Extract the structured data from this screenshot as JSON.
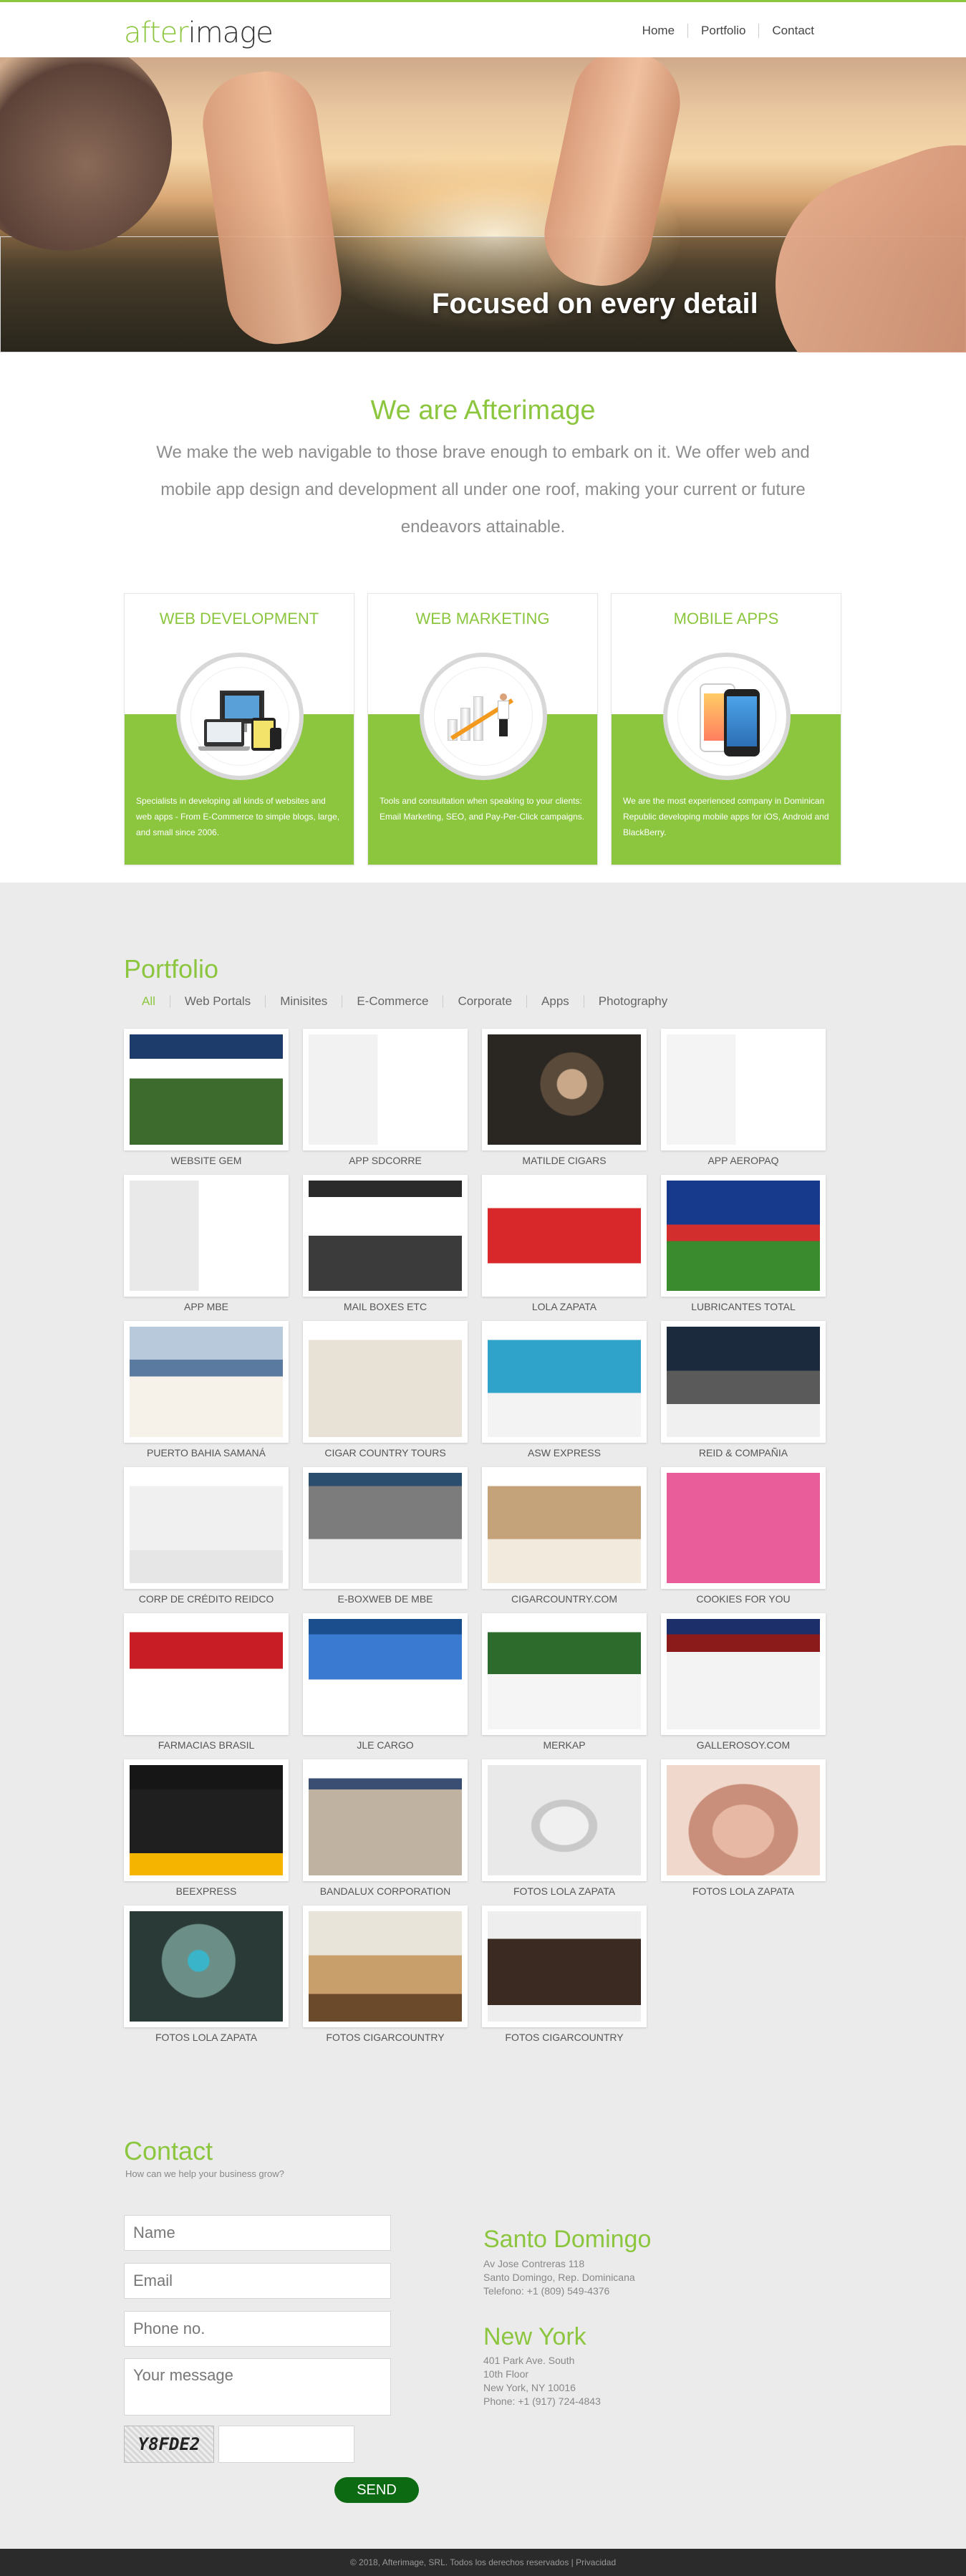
{
  "header": {
    "logo_part1": "after",
    "logo_part2": "image",
    "nav": [
      "Home",
      "Portfolio",
      "Contact"
    ]
  },
  "hero": {
    "caption": "Focused on every detail"
  },
  "intro": {
    "heading_prefix": "We are ",
    "heading_brand": "Afterimage",
    "body": "We make the web navigable to those brave enough to embark on it. We offer web and mobile app design and development all under one roof, making your current or future endeavors attainable."
  },
  "services": [
    {
      "title": "WEB DEVELOPMENT",
      "desc": "Specialists in developing all kinds of websites and web apps - From E-Commerce to simple blogs, large, and small since 2006."
    },
    {
      "title": "WEB MARKETING",
      "desc": "Tools and consultation when speaking to your clients: Email Marketing, SEO, and Pay-Per-Click campaigns."
    },
    {
      "title": "MOBILE APPS",
      "desc": "We are the most experienced company in Dominican Republic developing mobile apps for iOS, Android and BlackBerry."
    }
  ],
  "portfolio": {
    "title": "Portfolio",
    "filters": [
      "All",
      "Web Portals",
      "Minisites",
      "E-Commerce",
      "Corporate",
      "Apps",
      "Photography"
    ],
    "items": [
      "WEBSITE GEM",
      "APP SDCORRE",
      "MATILDE CIGARS",
      "APP AEROPAQ",
      "APP MBE",
      "MAIL BOXES ETC",
      "LOLA ZAPATA",
      "LUBRICANTES TOTAL",
      "PUERTO BAHIA SAMANÁ",
      "CIGAR COUNTRY TOURS",
      "ASW EXPRESS",
      "REID & COMPAÑIA",
      "CORP DE CRÉDITO REIDCO",
      "E-BOXWEB DE MBE",
      "CIGARCOUNTRY.COM",
      "COOKIES FOR YOU",
      "FARMACIAS BRASIL",
      "JLE CARGO",
      "MERKAP",
      "GALLEROSOY.COM",
      "BEEXPRESS",
      "BANDALUX CORPORATION",
      "FOTOS LOLA ZAPATA",
      "FOTOS LOLA ZAPATA",
      "FOTOS LOLA ZAPATA",
      "FOTOS CIGARCOUNTRY",
      "FOTOS CIGARCOUNTRY"
    ]
  },
  "contact": {
    "title": "Contact",
    "subtitle": "How can we help your business grow?",
    "placeholders": {
      "name": "Name",
      "email": "Email",
      "phone": "Phone no.",
      "message": "Your message"
    },
    "captcha_text": "Y8FDE2",
    "send_label": "SEND",
    "offices": [
      {
        "city": "Santo Domingo",
        "lines": [
          "Av Jose Contreras 118",
          "Santo Domingo, Rep. Dominicana",
          "Telefono: +1 (809) 549-4376"
        ]
      },
      {
        "city": "New York",
        "lines": [
          "401 Park Ave. South",
          "10th Floor",
          "New York, NY 10016",
          "Phone: +1 (917) 724-4843"
        ]
      }
    ]
  },
  "footer": {
    "text": "© 2018, Afterimage, SRL. Todos los derechos reservados | Privacidad"
  }
}
